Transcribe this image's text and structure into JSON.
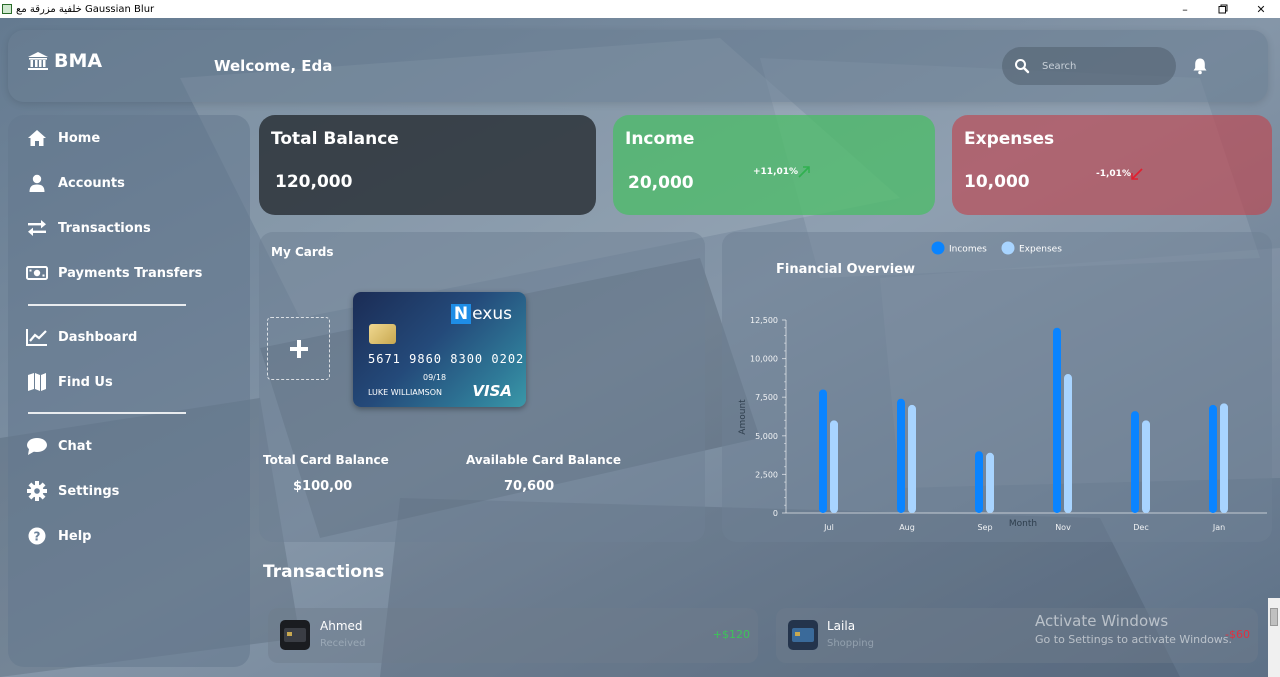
{
  "window": {
    "title": "خلفية مزرقة مع Gaussian Blur"
  },
  "header": {
    "brand": "BMA",
    "welcome": "Welcome, Eda",
    "search_placeholder": "Search"
  },
  "sidebar": {
    "items": [
      {
        "label": "Home",
        "icon": "home-icon"
      },
      {
        "label": "Accounts",
        "icon": "user-icon"
      },
      {
        "label": "Transactions",
        "icon": "exchange-icon"
      },
      {
        "label": "Payments Transfers",
        "icon": "money-icon"
      },
      {
        "label": "Dashboard",
        "icon": "chart-line-icon"
      },
      {
        "label": "Find Us",
        "icon": "map-icon"
      },
      {
        "label": "Chat",
        "icon": "chat-icon"
      },
      {
        "label": "Settings",
        "icon": "gear-icon"
      },
      {
        "label": "Help",
        "icon": "help-icon"
      }
    ]
  },
  "stats": {
    "total": {
      "label": "Total Balance",
      "value": "120,000"
    },
    "income": {
      "label": "Income",
      "value": "20,000",
      "delta": "+11,01%",
      "color": "#48be64"
    },
    "expenses": {
      "label": "Expenses",
      "value": "10,000",
      "delta": "-1,01%",
      "color": "#be4650"
    }
  },
  "cards": {
    "title": "My Cards",
    "card": {
      "brand_letter": "N",
      "brand_rest": "exus",
      "number": "5671 9860 8300 0202",
      "expiry": "09/18",
      "holder": "LUKE WILLIAMSON",
      "network": "VISA"
    },
    "total_label": "Total Card Balance",
    "total_value": "$100,00",
    "available_label": "Available Card Balance",
    "available_value": "70,600"
  },
  "chart_data": {
    "type": "bar",
    "title": "Financial Overview",
    "xlabel": "Month",
    "ylabel": "Amount",
    "categories": [
      "Jul",
      "Aug",
      "Sep",
      "Nov",
      "Dec",
      "Jan"
    ],
    "series": [
      {
        "name": "Incomes",
        "values": [
          8000,
          7400,
          4000,
          12000,
          6600,
          7000
        ],
        "color": "#0a84ff"
      },
      {
        "name": "Expenses",
        "values": [
          6000,
          7000,
          3900,
          9000,
          6000,
          7100
        ],
        "color": "#a8d4ff"
      }
    ],
    "ylim": [
      0,
      12500
    ],
    "yticks": [
      "0",
      "2,500",
      "5,000",
      "7,500",
      "10,000",
      "12,500"
    ],
    "ytick_values": [
      0,
      2500,
      5000,
      7500,
      10000,
      12500
    ],
    "legend": "top-center",
    "grid": false
  },
  "transactions": {
    "title": "Transactions",
    "items": [
      {
        "name": "Ahmed",
        "sub": "Received",
        "amount": "+$120",
        "amount_color": "#3ec35a"
      },
      {
        "name": "Laila",
        "sub": "Shopping",
        "amount": "-$60",
        "amount_color": "#e03040"
      }
    ]
  },
  "watermark": {
    "line1": "Activate Windows",
    "line2": "Go to Settings to activate Windows."
  }
}
